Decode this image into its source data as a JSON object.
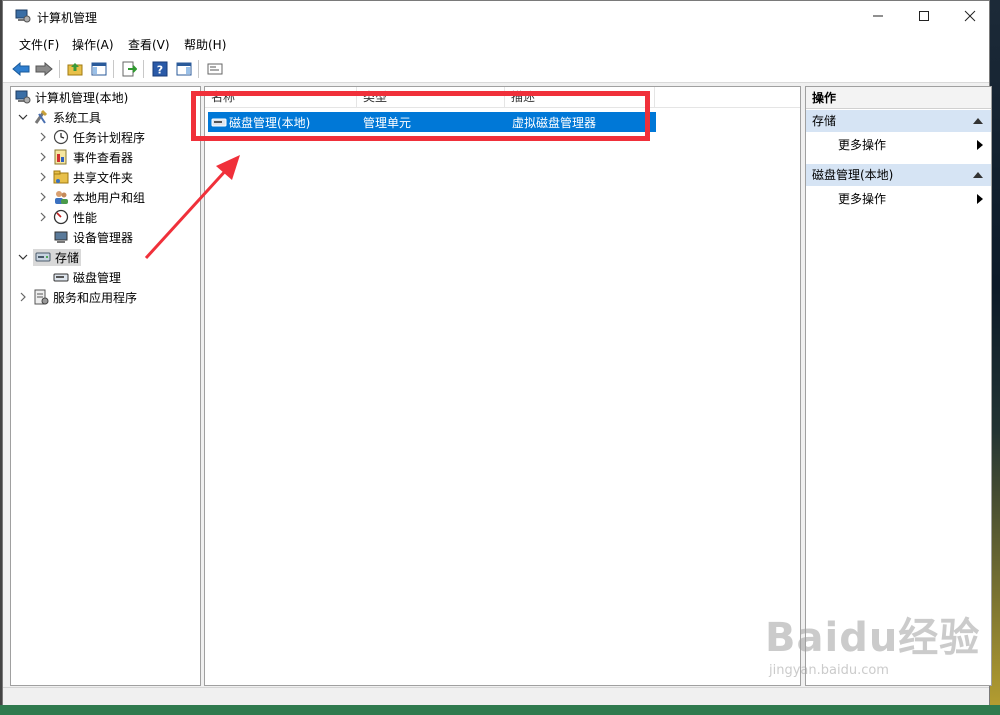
{
  "window": {
    "title": "计算机管理"
  },
  "menu": [
    "文件(F)",
    "操作(A)",
    "查看(V)",
    "帮助(H)"
  ],
  "tree": {
    "root": "计算机管理(本地)",
    "system_tools": "系统工具",
    "task_scheduler": "任务计划程序",
    "event_viewer": "事件查看器",
    "shared_folders": "共享文件夹",
    "local_users": "本地用户和组",
    "performance": "性能",
    "device_manager": "设备管理器",
    "storage": "存储",
    "disk_management": "磁盘管理",
    "services_apps": "服务和应用程序"
  },
  "list": {
    "columns": [
      "名称",
      "类型",
      "描述"
    ],
    "rows": [
      {
        "name": "磁盘管理(本地)",
        "type": "管理单元",
        "description": "虚拟磁盘管理器"
      }
    ]
  },
  "actions": {
    "title": "操作",
    "sections": [
      {
        "label": "存储",
        "item": "更多操作"
      },
      {
        "label": "磁盘管理(本地)",
        "item": "更多操作"
      }
    ]
  },
  "watermark": {
    "main": "Baidu经验",
    "sub": "jingyan.baidu.com"
  },
  "colors": {
    "selection": "#0078d7",
    "annotation": "#f0303a",
    "section_header": "#d6e4f4"
  }
}
